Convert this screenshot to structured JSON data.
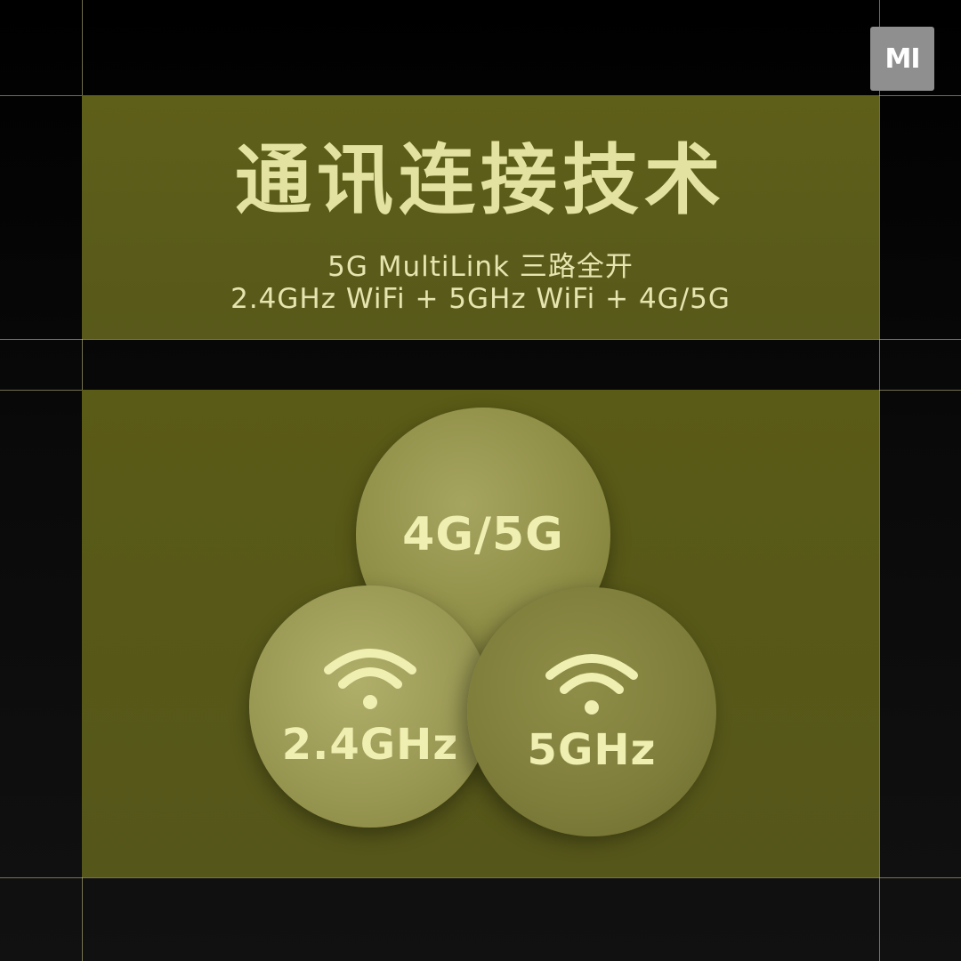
{
  "logo": {
    "text": "MI"
  },
  "header": {
    "title": "通讯连接技术",
    "line1": "5G MultiLink 三路全开",
    "line2": "2.4GHz WiFi + 5GHz WiFi + 4G/5G"
  },
  "bubbles": {
    "cellular": {
      "label": "4G/5G"
    },
    "wifi_24": {
      "label": "2.4GHz",
      "icon": "wifi-icon"
    },
    "wifi_5": {
      "label": "5GHz",
      "icon": "wifi-icon"
    }
  },
  "colors": {
    "panel": "#5b5c18",
    "text": "#e3e2a0",
    "guide": "#c8c88c"
  }
}
